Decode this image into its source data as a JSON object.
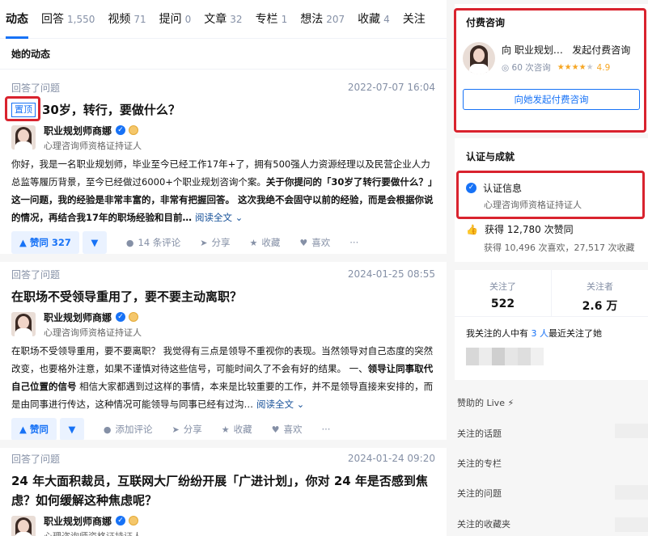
{
  "tabs": [
    {
      "label": "动态",
      "count": ""
    },
    {
      "label": "回答",
      "count": "1,550"
    },
    {
      "label": "视频",
      "count": "71"
    },
    {
      "label": "提问",
      "count": "0"
    },
    {
      "label": "文章",
      "count": "32"
    },
    {
      "label": "专栏",
      "count": "1"
    },
    {
      "label": "想法",
      "count": "207"
    },
    {
      "label": "收藏",
      "count": "4"
    },
    {
      "label": "关注",
      "count": ""
    }
  ],
  "section_title": "她的动态",
  "author": {
    "name": "职业规划师商娜",
    "desc": "心理咨询师资格证持证人"
  },
  "items": [
    {
      "type": "回答了问题",
      "time": "2022-07-07 16:04",
      "pin": "置顶",
      "title": "30岁，转行，要做什么？",
      "content_1": "你好，我是一名职业规划师，毕业至今已经工作17年+了，拥有500强人力资源经理以及民营企业人力总监等履历背景，至今已经做过6000+个职业规划咨询个案。",
      "content_2": "关于你提问的「30岁了转行要做什么？」这一问题，我的经验是非常丰富的，非常有把握回答。 这次我绝不会固守以前的经验，而是会根据你说的情况，再结合我17年的职场经验和目前…",
      "read_more": "阅读全文",
      "vote": "赞同 327",
      "comment": "14 条评论",
      "share": "分享",
      "collect": "收藏",
      "like": "喜欢",
      "more": "···"
    },
    {
      "type": "回答了问题",
      "time": "2024-01-25 08:55",
      "title": "在职场不受领导重用了，要不要主动离职？",
      "content_1": "在职场不受领导重用，要不要离职？ 我觉得有三点是领导不重视你的表现。当然领导对自己态度的突然改变，也要格外注意，如果不谨慎对待这些信号，可能时间久了不会有好的结果。 一、",
      "content_2": "领导让同事取代自己位置的信号",
      "content_3": " 相信大家都遇到过这样的事情，本来是比较重要的工作，并不是领导直接来安排的，而是由同事进行传达，这种情况可能领导与同事已经有过沟…",
      "read_more": "阅读全文",
      "vote": "赞同",
      "comment": "添加评论",
      "share": "分享",
      "collect": "收藏",
      "like": "喜欢",
      "more": "···"
    },
    {
      "type": "回答了问题",
      "time": "2024-01-24 09:20",
      "title": "24 年大面积裁员，互联网大厂纷纷开展「广进计划」，你对 24 年是否感到焦虑？如何缓解这种焦虑呢？"
    }
  ],
  "sidebar": {
    "consult_title": "付费咨询",
    "consult_name": "向 职业规划…",
    "consult_action": "发起付费咨询",
    "consult_count": "60 次咨询",
    "rating": "4.9",
    "consult_button": "向她发起付费咨询",
    "cert_title": "认证与成就",
    "cert_label": "认证信息",
    "cert_desc": "心理咨询师资格证持证人",
    "likes_label": "获得 12,780 次赞同",
    "likes_sub": "获得 10,496 次喜欢，27,517 次收藏",
    "following_label": "关注了",
    "following_val": "522",
    "followers_label": "关注者",
    "followers_val": "2.6 万",
    "mutual_pre": "我关注的人中有 ",
    "mutual_num": "3 人",
    "mutual_post": "最近关注了她",
    "links": [
      "赞助的 Live ⚡",
      "关注的话题",
      "关注的专栏",
      "关注的问题",
      "关注的收藏夹"
    ]
  },
  "colors": {
    "accent": "#1772f6",
    "highlight_box": "#d9232e",
    "star": "#f6a623"
  }
}
